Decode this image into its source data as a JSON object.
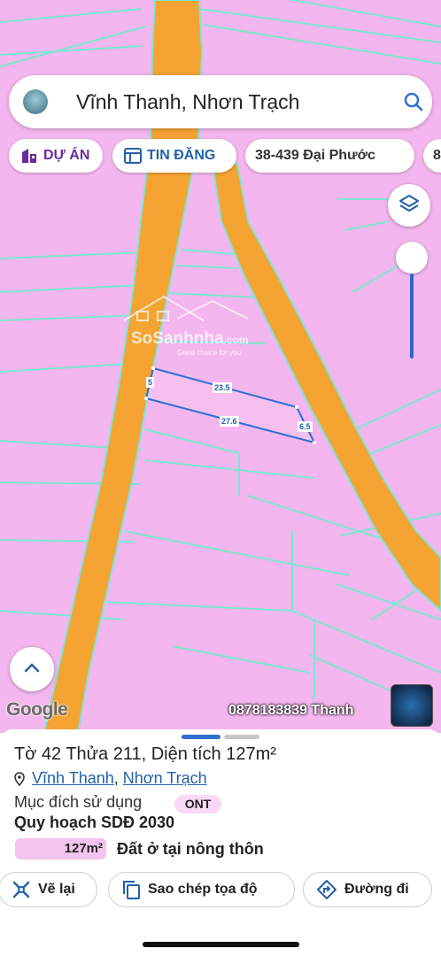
{
  "search": {
    "title": "Vĩnh Thanh, Nhơn Trạch",
    "avatar_icon": "user-avatar",
    "search_icon": "search-icon"
  },
  "chips": [
    {
      "label": "DỰ ÁN",
      "icon": "building-icon"
    },
    {
      "label": "TIN ĐĂNG",
      "icon": "listing-icon"
    },
    {
      "label": "38-439 Đại Phước"
    },
    {
      "label": "8"
    }
  ],
  "map": {
    "colors": {
      "land": "#f4b6ee",
      "road": "#f5a332",
      "parcel_line": "#7de6d5",
      "selection": "#2e6fd1"
    },
    "watermark": "SoSanhnha",
    "watermark_suffix": ".com",
    "watermark_tagline": "Great choice for you",
    "dimension_labels": [
      "5",
      "23.5",
      "27.6",
      "6.5"
    ],
    "google_label": "Google",
    "phone_label": "0878183839 Thanh",
    "layers_icon": "layers-icon",
    "zoom_slider_level": 0.0,
    "scroll_up_icon": "chevron-up-icon"
  },
  "sheet": {
    "title": "Tờ 42 Thửa 211, Diện tích 127m²",
    "location_ward": "Vĩnh Thanh",
    "location_sep": ", ",
    "location_district": "Nhơn Trạch",
    "purpose_label": "Mục đích sử dụng",
    "purpose_code": "ONT",
    "plan_label": "Quy hoạch SDĐ 2030",
    "area_value": "127m²",
    "land_use": "Đất ở tại nông thôn",
    "buttons": [
      {
        "label": "Vẽ lại",
        "icon": "redraw-icon"
      },
      {
        "label": "Sao chép tọa độ",
        "icon": "copy-icon"
      },
      {
        "label": "Đường đi",
        "icon": "directions-icon"
      }
    ]
  }
}
